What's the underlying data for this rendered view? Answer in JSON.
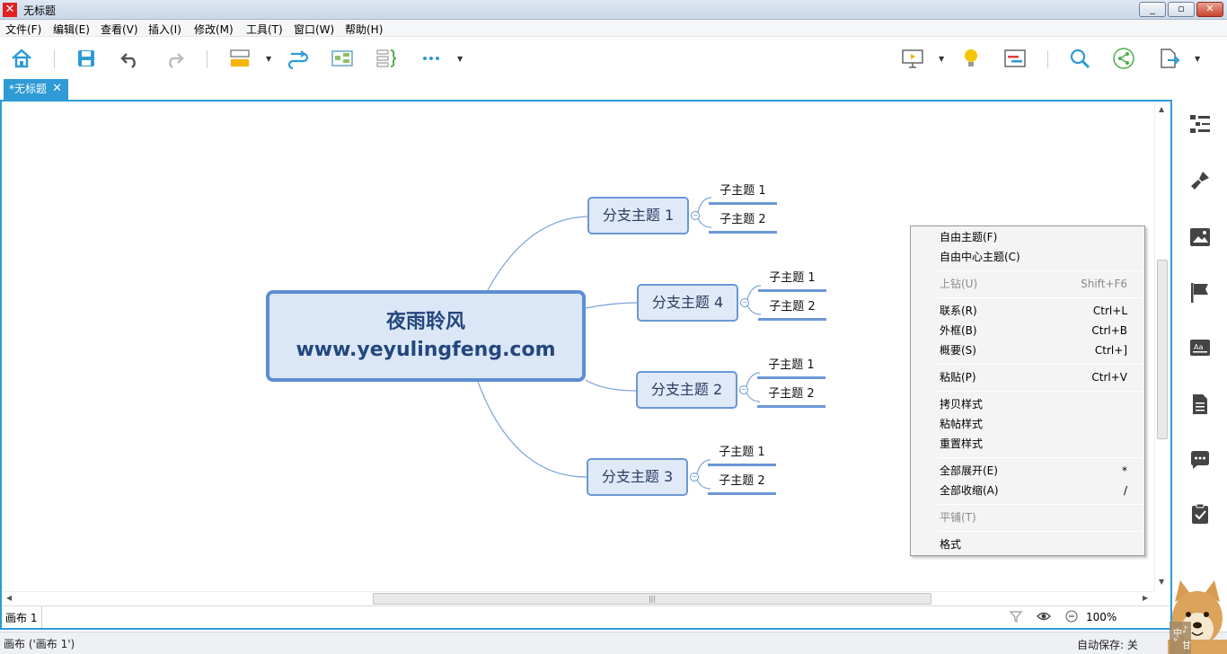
{
  "window": {
    "title": "无标题",
    "min": "_",
    "max": "▫",
    "close": "✕"
  },
  "menu": [
    "文件(F)",
    "编辑(E)",
    "查看(V)",
    "插入(I)",
    "修改(M)",
    "工具(T)",
    "窗口(W)",
    "帮助(H)"
  ],
  "tabs": [
    {
      "label": "*无标题",
      "close": "✕"
    }
  ],
  "mindmap": {
    "central": {
      "line1": "夜雨聆风",
      "line2": "www.yeyulingfeng.com"
    },
    "branches": [
      {
        "label": "分支主题 1",
        "subs": [
          "子主题 1",
          "子主题 2"
        ]
      },
      {
        "label": "分支主题 4",
        "subs": [
          "子主题 1",
          "子主题 2"
        ]
      },
      {
        "label": "分支主题 2",
        "subs": [
          "子主题 1",
          "子主题 2"
        ]
      },
      {
        "label": "分支主题 3",
        "subs": [
          "子主题 1",
          "子主题 2"
        ]
      }
    ],
    "collapse_glyph": "−"
  },
  "context_menu": {
    "items": [
      {
        "label": "自由主题(F)",
        "shortcut": ""
      },
      {
        "label": "自由中心主题(C)",
        "shortcut": ""
      },
      {
        "label": "上钻(U)",
        "shortcut": "Shift+F6",
        "disabled": true
      },
      {
        "label": "联系(R)",
        "shortcut": "Ctrl+L"
      },
      {
        "label": "外框(B)",
        "shortcut": "Ctrl+B"
      },
      {
        "label": "概要(S)",
        "shortcut": "Ctrl+]"
      },
      {
        "label": "粘贴(P)",
        "shortcut": "Ctrl+V"
      },
      {
        "label": "拷贝样式",
        "shortcut": ""
      },
      {
        "label": "粘帖样式",
        "shortcut": ""
      },
      {
        "label": "重置样式",
        "shortcut": ""
      },
      {
        "label": "全部展开(E)",
        "shortcut": "*"
      },
      {
        "label": "全部收缩(A)",
        "shortcut": "/"
      },
      {
        "label": "平铺(T)",
        "shortcut": "",
        "disabled": true
      },
      {
        "label": "格式",
        "shortcut": ""
      }
    ]
  },
  "sheetbar": {
    "sheet_tab": "画布 1",
    "zoom": "100%"
  },
  "statusbar": {
    "left": "画布 ('画布 1')",
    "right": "自动保存: 关"
  },
  "mascot": {
    "text1": "中",
    "text2": "♪",
    "text3": "°",
    "text4": "甘"
  },
  "colors": {
    "accent": "#2e9ad6",
    "central_border": "#5d8ed3",
    "branch_border": "#6b97d6",
    "branch_fill": "#dfe9f7",
    "connector": "#7ea3d8"
  }
}
